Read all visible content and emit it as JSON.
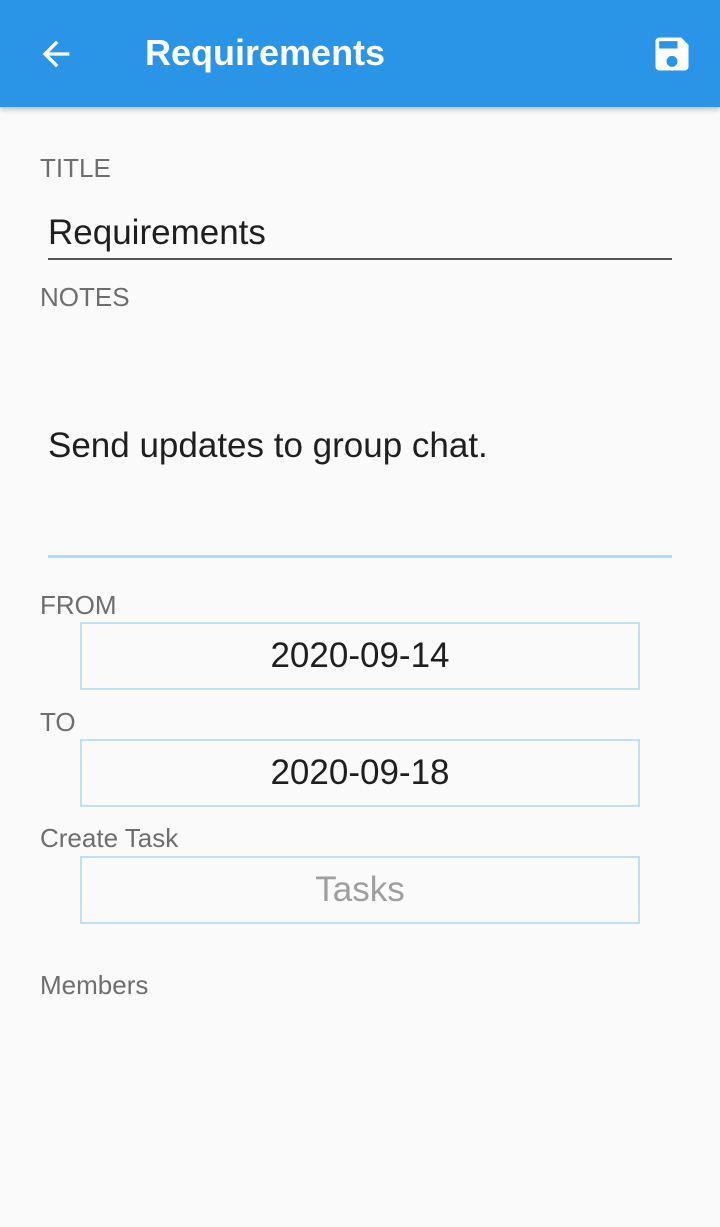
{
  "appbar": {
    "title": "Requirements",
    "back_icon": "arrow-left-icon",
    "save_icon": "floppy-disk-icon",
    "color": "#2a95e6"
  },
  "form": {
    "title_label": "TITLE",
    "title_value": "Requirements",
    "notes_label": "NOTES",
    "notes_value": "Send updates to group chat.",
    "from_label": "FROM",
    "from_value": "2020-09-14",
    "to_label": "TO",
    "to_value": "2020-09-18",
    "create_task_label": "Create Task",
    "tasks_button": "Tasks",
    "members_label": "Members"
  },
  "colors": {
    "field_border": "#bfe0f4",
    "notes_underline": "#b3dbf2",
    "label": "#6e6e6e"
  }
}
